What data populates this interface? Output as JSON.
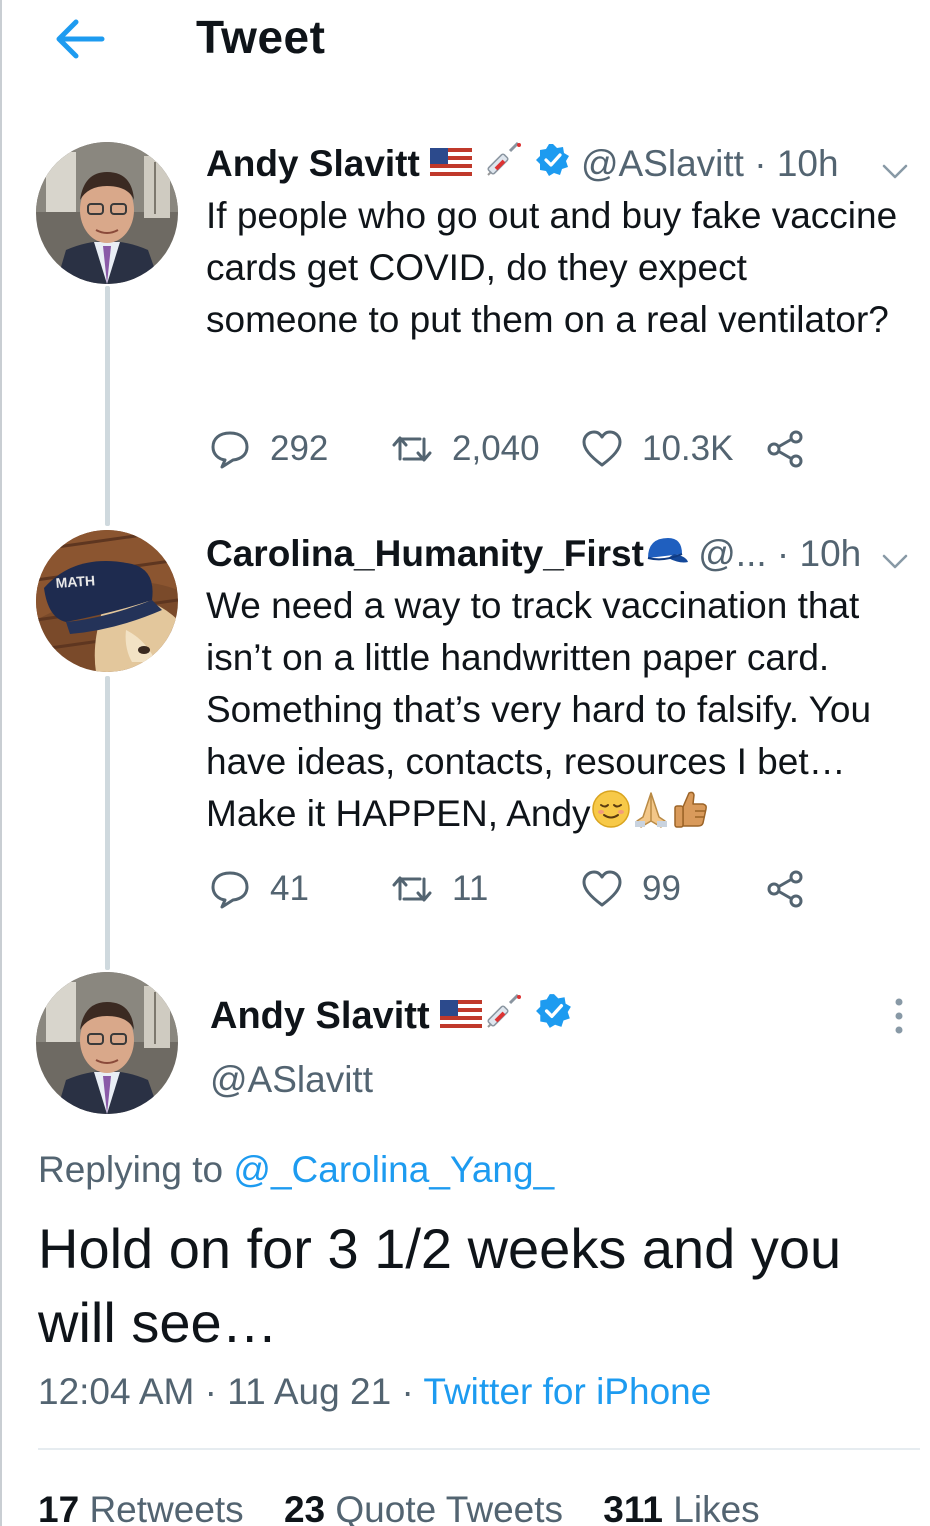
{
  "header": {
    "title": "Tweet",
    "back_icon": "arrow-left-icon"
  },
  "colors": {
    "accent": "#1d9bf0",
    "secondary_text": "#536471",
    "verified": "#1d9bf0"
  },
  "thread": [
    {
      "name": "Andy Slavitt",
      "name_emojis": [
        "us-flag-emoji",
        "syringe-emoji"
      ],
      "verified": true,
      "handle": "@ASlavitt",
      "dot": "·",
      "time": "10h",
      "text": "If people who go out and buy fake vaccine cards get COVID, do they expect someone to put them on a real ventilator?",
      "replies": "292",
      "retweets": "2,040",
      "likes": "10.3K"
    },
    {
      "name": "Carolina_Humanity_First",
      "name_emojis": [
        "blue-cap-emoji"
      ],
      "verified": false,
      "handle": "@...",
      "dot": "·",
      "time": "10h",
      "avatar_hat_text": "MATH",
      "text": "We need a way to track vaccination that isn’t on a little handwritten paper card. Something that’s very hard to falsify. You have ideas, contacts, resources I bet… Make it HAPPEN, Andy",
      "text_emojis": [
        "relieved-face-emoji",
        "folded-hands-emoji",
        "thumbs-up-emoji"
      ],
      "replies": "41",
      "retweets": "11",
      "likes": "99"
    }
  ],
  "main_tweet": {
    "name": "Andy Slavitt",
    "name_emojis": [
      "us-flag-emoji",
      "syringe-emoji"
    ],
    "verified": true,
    "handle": "@ASlavitt",
    "replying_prefix": "Replying to",
    "replying_to": "@_Carolina_Yang_",
    "text": "Hold on for 3 1/2 weeks and you will see…",
    "time": "12:04 AM",
    "date": "11 Aug 21",
    "separator": "·",
    "source": "Twitter for iPhone",
    "retweets_count": "17",
    "retweets_label": "Retweets",
    "quotes_count": "23",
    "quotes_label": "Quote Tweets",
    "likes_count": "311",
    "likes_label": "Likes"
  }
}
